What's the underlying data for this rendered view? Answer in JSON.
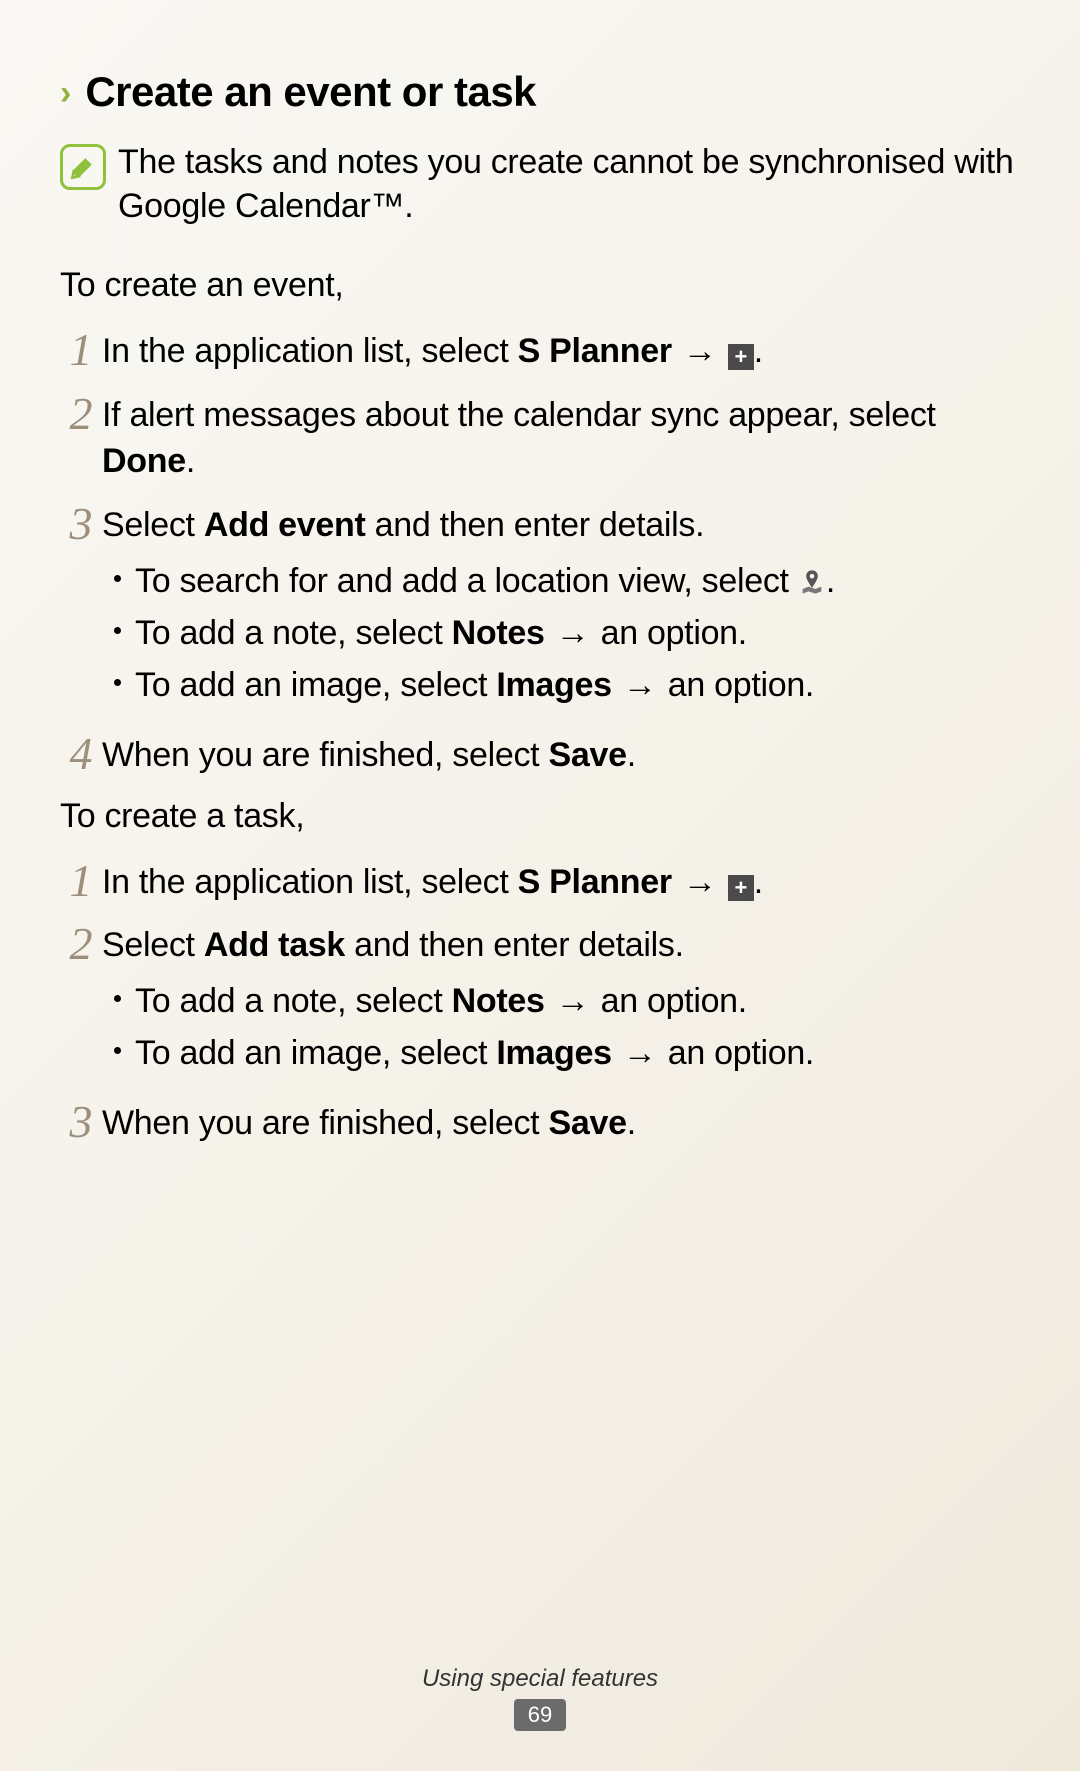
{
  "heading": "Create an event or task",
  "note": {
    "text_pre": "The tasks and notes you create cannot be synchronised with Google Calendar",
    "tm": "™",
    "text_post": "."
  },
  "section_event": {
    "intro": "To create an event,",
    "steps": {
      "s1": {
        "num": "1",
        "t1": "In the application list, select ",
        "b1": "S Planner",
        "arrow": " → ",
        "period": "."
      },
      "s2": {
        "num": "2",
        "t1": "If alert messages about the calendar sync appear, select ",
        "b1": "Done",
        "t2": "."
      },
      "s3": {
        "num": "3",
        "t1": "Select ",
        "b1": "Add event",
        "t2": " and then enter details.",
        "bul1": {
          "t1": "To search for and add a location view, select ",
          "t2": "."
        },
        "bul2": {
          "t1": "To add a note, select ",
          "b1": "Notes",
          "arrow": " → ",
          "t2": "an option."
        },
        "bul3": {
          "t1": "To add an image, select ",
          "b1": "Images",
          "arrow": " → ",
          "t2": "an option."
        }
      },
      "s4": {
        "num": "4",
        "t1": "When you are finished, select ",
        "b1": "Save",
        "t2": "."
      }
    }
  },
  "section_task": {
    "intro": "To create a task,",
    "steps": {
      "s1": {
        "num": "1",
        "t1": "In the application list, select ",
        "b1": "S Planner",
        "arrow": " → ",
        "period": "."
      },
      "s2": {
        "num": "2",
        "t1": "Select ",
        "b1": "Add task",
        "t2": " and then enter details.",
        "bul1": {
          "t1": "To add a note, select ",
          "b1": "Notes",
          "arrow": " → ",
          "t2": "an option."
        },
        "bul2": {
          "t1": "To add an image, select ",
          "b1": "Images",
          "arrow": " → ",
          "t2": "an option."
        }
      },
      "s3": {
        "num": "3",
        "t1": "When you are finished, select ",
        "b1": "Save",
        "t2": "."
      }
    }
  },
  "footer": {
    "title": "Using special features",
    "page": "69"
  }
}
